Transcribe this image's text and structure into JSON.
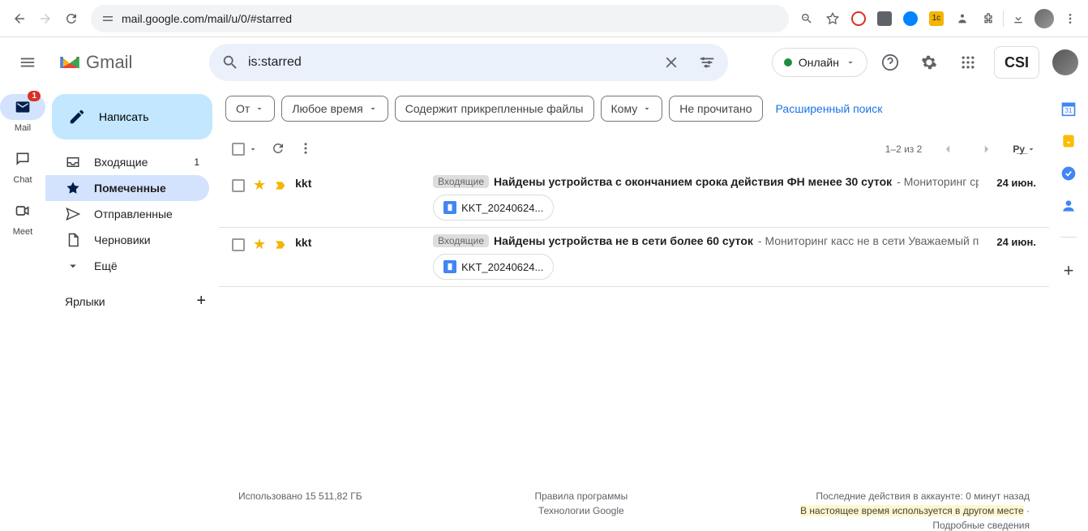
{
  "browser": {
    "url": "mail.google.com/mail/u/0/#starred"
  },
  "header": {
    "search_value": "is:starred",
    "status": "Онлайн",
    "org": "CSI"
  },
  "rail": {
    "mail": "Mail",
    "mail_badge": "1",
    "chat": "Chat",
    "meet": "Meet"
  },
  "compose": "Написать",
  "nav": {
    "inbox": "Входящие",
    "inbox_count": "1",
    "starred": "Помеченные",
    "sent": "Отправленные",
    "drafts": "Черновики",
    "more": "Ещё"
  },
  "labels_header": "Ярлыки",
  "filters": {
    "from": "От",
    "anytime": "Любое время",
    "has_attachment": "Содержит прикрепленные файлы",
    "to": "Кому",
    "unread": "Не прочитано",
    "advanced": "Расширенный поиск"
  },
  "pagination": "1–2 из 2",
  "input_label": "Р̲у̲",
  "inbox_tag": "Входящие",
  "mails": [
    {
      "sender": "kkt",
      "subject": "Найдены устройства с окончанием срока действия ФН менее 30 суток",
      "preview": " - Мониторинг сро...",
      "attachment": "KKT_20240624...",
      "date": "24 июн."
    },
    {
      "sender": "kkt",
      "subject": "Найдены устройства не в сети более 60 суток",
      "preview": " - Мониторинг касс не в сети Уважаемый польз...",
      "attachment": "KKT_20240624...",
      "date": "24 июн."
    }
  ],
  "footer": {
    "storage": "Использовано 15 511,82 ГБ",
    "terms": "Правила программы",
    "powered": "Технологии Google",
    "activity": "Последние действия в аккаунте: 0 минут назад",
    "warning": "В настоящее время используется в другом месте",
    "details": "Подробные сведения"
  }
}
